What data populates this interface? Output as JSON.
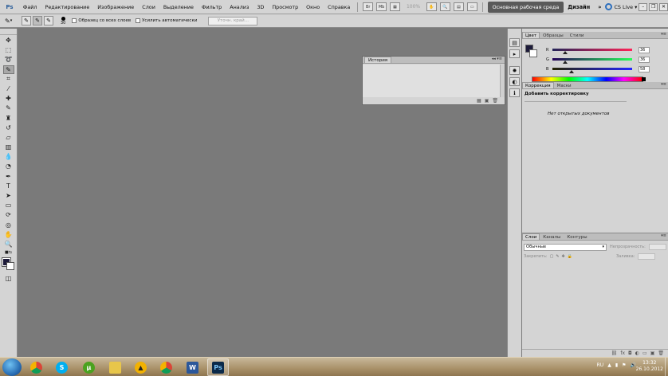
{
  "app": {
    "logo": "Ps"
  },
  "menu": {
    "items": [
      "Файл",
      "Редактирование",
      "Изображение",
      "Слои",
      "Выделение",
      "Фильтр",
      "Анализ",
      "3D",
      "Просмотр",
      "Окно",
      "Справка"
    ],
    "zoom": "100%",
    "workspace_active": "Основная рабочая среда",
    "workspace_alt": "Дизайн",
    "workspace_more": "»",
    "cslive": "CS Live"
  },
  "options": {
    "brush_size": "30",
    "sample_all_layers": "Образец со всех слоев",
    "auto_enhance": "Усилить автоматически",
    "refine_edge": "Уточн. край..."
  },
  "panels": {
    "history": {
      "tab": "История",
      "collapse": "◂◂ ▾≡"
    },
    "color": {
      "tabs": [
        "Цвет",
        "Образцы",
        "Стили"
      ],
      "r_label": "R",
      "r_value": "36",
      "g_label": "G",
      "g_value": "36",
      "b_label": "B",
      "b_value": "58",
      "colors": {
        "foreground": "#1d1b3a",
        "background": "#ffffff"
      }
    },
    "adjustments": {
      "tabs": [
        "Коррекция",
        "Маски"
      ],
      "title": "Добавить корректировку",
      "no_docs": "Нет открытых документов"
    },
    "layers": {
      "tabs": [
        "Слои",
        "Каналы",
        "Контуры"
      ],
      "blend_mode": "Обычные",
      "opacity_label": "Непрозрачность:",
      "lock_label": "Закрепить:",
      "fill_label": "Заливка:"
    }
  },
  "taskbar": {
    "lang": "RU",
    "time": "13:32",
    "date": "26.10.2012",
    "ps_label": "Ps"
  }
}
